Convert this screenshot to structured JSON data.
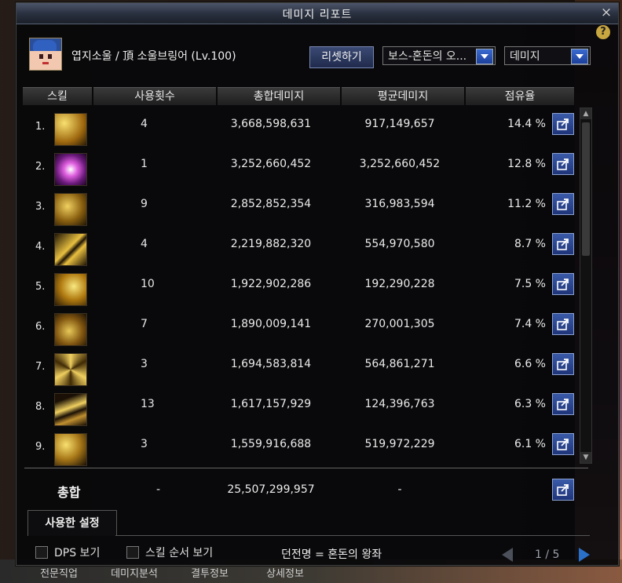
{
  "window": {
    "title": "데미지 리포트"
  },
  "help_label": "?",
  "close_label": "×",
  "character": {
    "name": "엽지소울 / 頂 소울브링어 (Lv.100)"
  },
  "controls": {
    "reset_label": "리셋하기",
    "boss_select_value": "보스-혼돈의 오...",
    "type_select_value": "데미지"
  },
  "table": {
    "headers": {
      "skill": "스킬",
      "count": "사용횟수",
      "total": "총합데미지",
      "avg": "평균데미지",
      "share": "점유율"
    },
    "rows": [
      {
        "rank": "1.",
        "count": "4",
        "total": "3,668,598,631",
        "avg": "917,149,657",
        "share": "14.4 %",
        "icon": "skill-slash-icon"
      },
      {
        "rank": "2.",
        "count": "1",
        "total": "3,252,660,452",
        "avg": "3,252,660,452",
        "share": "12.8 %",
        "icon": "skill-burst-icon"
      },
      {
        "rank": "3.",
        "count": "9",
        "total": "2,852,852,354",
        "avg": "316,983,594",
        "share": "11.2 %",
        "icon": "skill-claw-icon"
      },
      {
        "rank": "4.",
        "count": "4",
        "total": "2,219,882,320",
        "avg": "554,970,580",
        "share": "8.7 %",
        "icon": "skill-cross-icon"
      },
      {
        "rank": "5.",
        "count": "10",
        "total": "1,922,902,286",
        "avg": "192,290,228",
        "share": "7.5 %",
        "icon": "skill-sword-icon"
      },
      {
        "rank": "6.",
        "count": "7",
        "total": "1,890,009,141",
        "avg": "270,001,305",
        "share": "7.4 %",
        "icon": "skill-wave-icon"
      },
      {
        "rank": "7.",
        "count": "3",
        "total": "1,694,583,814",
        "avg": "564,861,271",
        "share": "6.6 %",
        "icon": "skill-star-icon"
      },
      {
        "rank": "8.",
        "count": "13",
        "total": "1,617,157,929",
        "avg": "124,396,763",
        "share": "6.3 %",
        "icon": "skill-dash-icon"
      },
      {
        "rank": "9.",
        "count": "3",
        "total": "1,559,916,688",
        "avg": "519,972,229",
        "share": "6.1 %",
        "icon": "skill-moon-icon"
      }
    ],
    "total": {
      "label": "총합",
      "count": "-",
      "sum": "25,507,299,957",
      "avg": "-"
    }
  },
  "settings_tab_label": "사용한 설정",
  "options": {
    "dps_label": "DPS 보기",
    "order_label": "스킬 순서 보기"
  },
  "dungeon_text": "던전명 = 혼돈의 왕좌",
  "pager": {
    "text": "1 / 5"
  },
  "background_tabs": [
    "전문직업",
    "데미지분석",
    "결투정보",
    "상세정보"
  ],
  "colors": {
    "accent_blue": "#2a5ab0",
    "gold": "#d8b040"
  }
}
